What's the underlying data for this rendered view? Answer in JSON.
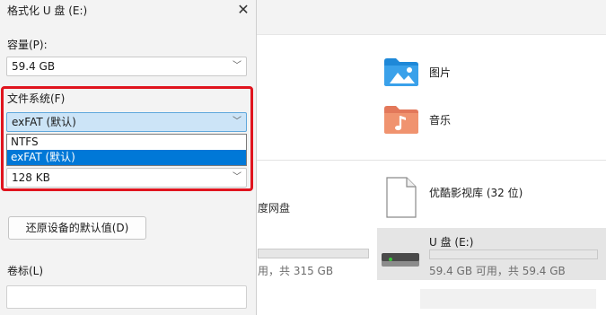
{
  "dialog": {
    "title": "格式化 U 盘 (E:)",
    "close_glyph": "✕",
    "capacity": {
      "label": "容量(P):",
      "value": "59.4 GB"
    },
    "filesystem": {
      "label": "文件系统(F)",
      "value": "exFAT (默认)",
      "options": [
        "NTFS",
        "exFAT (默认)"
      ],
      "selected_index": 1
    },
    "allocation": {
      "value": "128 KB"
    },
    "restore_button": "还原设备的默认值(D)",
    "volume": {
      "label": "卷标(L)",
      "value": ""
    }
  },
  "explorer": {
    "quick_access": [
      {
        "label": "图片",
        "icon": "pictures-folder-icon"
      },
      {
        "label": "音乐",
        "icon": "music-folder-icon"
      }
    ],
    "drives": [
      {
        "name": "优酷影视库 (32 位)",
        "icon": "file-icon"
      },
      {
        "name": "U 盘 (E:)",
        "icon": "drive-icon",
        "space": "59.4 GB 可用，共 59.4 GB",
        "used_fraction": 0.0
      }
    ],
    "partial_texts": {
      "cloud_drive": "度网盘",
      "disk_space": "用，共 315 GB"
    }
  },
  "colors": {
    "highlight_border": "#e0141e",
    "selection": "#0078d7",
    "combo_active": "#cce4f7"
  }
}
